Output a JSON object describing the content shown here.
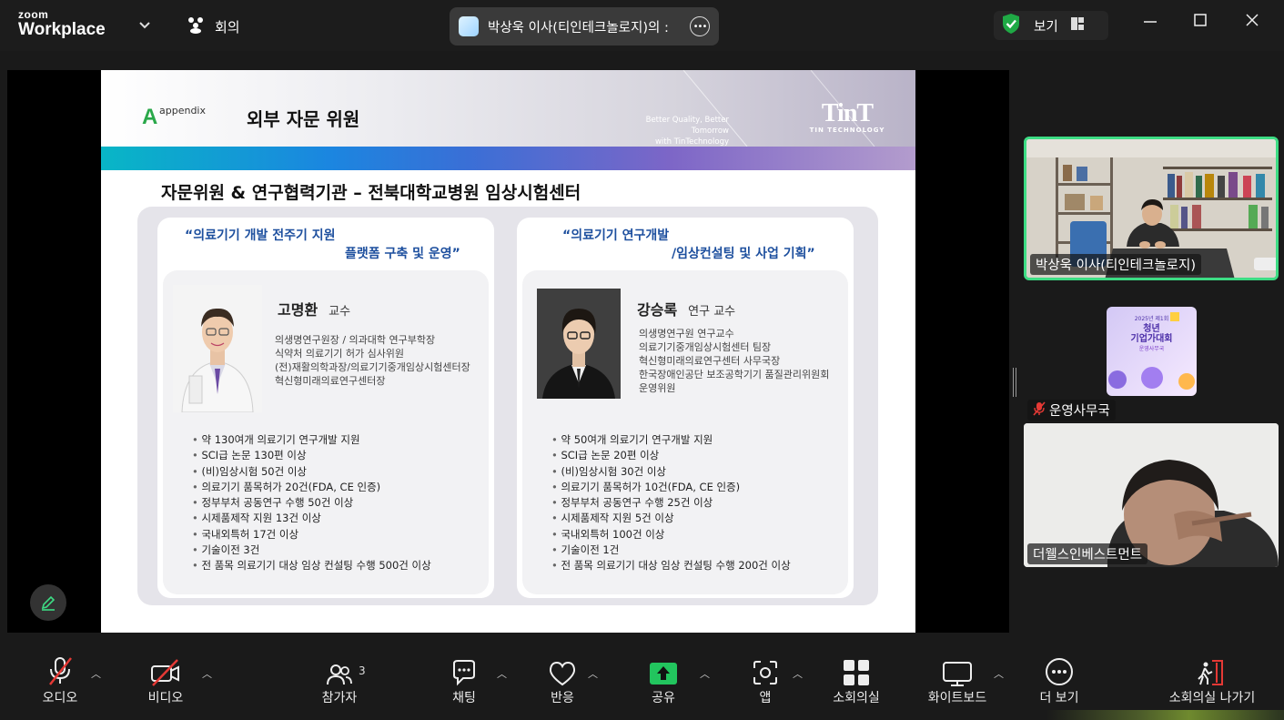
{
  "app": {
    "brand_line1": "zoom",
    "brand_line2": "Workplace",
    "meeting_label": "회의"
  },
  "share_pill": {
    "text": "박상욱 이사(티인테크놀로지)의 :"
  },
  "view_button": {
    "label": "보기"
  },
  "slide": {
    "appendix_letter": "A",
    "appendix_text": "appendix",
    "title": "외부 자문 위원",
    "tagline_1": "Better Quality, Better Tomorrow",
    "tagline_2": "with TinTechnology",
    "logo_big": "TinT",
    "logo_small": "TIN TECHNOLOGY",
    "subtitle": "자문위원 & 연구협력기관 – 전북대학교병원 임상시험센터",
    "left": {
      "quote_1": "“의료기기 개발 전주기 지원",
      "quote_2": "플랫폼 구축 및 운영”",
      "name": "고명환",
      "role": "교수",
      "cv": [
        "의생명연구원장 /  의과대학 연구부학장",
        "식약처 의료기기 허가 심사위원",
        "(전)재활의학과장/의료기기중개임상시험센터장",
        "혁신형미래의료연구센터장"
      ],
      "achievements": [
        "약 130여개 의료기기 연구개발 지원",
        "SCI급 논문 130편 이상",
        "(비)임상시험 50건 이상",
        "의료기기 품목허가 20건(FDA, CE 인증)",
        "정부부처 공동연구 수행 50건 이상",
        "시제품제작 지원 13건 이상",
        "국내외특허 17건 이상",
        "기술이전 3건",
        "전 품목 의료기기 대상 임상 컨설팅 수행 500건 이상"
      ]
    },
    "right": {
      "quote_1": "“의료기기 연구개발",
      "quote_2": "/임상컨설팅 및 사업 기획”",
      "name": "강승록",
      "role": "연구 교수",
      "cv": [
        "의생명연구원 연구교수",
        "의료기기중개임상시험센터 팀장",
        "혁신형미래의료연구센터 사무국장",
        "한국장애인공단 보조공학기기 품질관리위원회",
        "운영위원"
      ],
      "achievements": [
        "약 50여개 의료기기 연구개발 지원",
        "SCI급 논문 20편 이상",
        "(비)임상시험 30건 이상",
        "의료기기 품목허가 10건(FDA, CE 인증)",
        "정부부처 공동연구 수행 25건 이상",
        "시제품제작 지원 5건 이상",
        "국내외특허 100건 이상",
        "기술이전 1건",
        "전 품목 의료기기 대상 임상 컨설팅 수행 200건 이상"
      ]
    }
  },
  "participants": [
    {
      "name": "박상욱 이사(티인테크놀로지)",
      "active": true
    },
    {
      "name": "운영사무국",
      "muted": true,
      "poster_line1": "2025년 제1회",
      "poster_line2": "청년",
      "poster_line3": "기업가대회",
      "poster_line4": "운영사무국"
    },
    {
      "name": "더웰스인베스트먼트"
    }
  ],
  "toolbar": {
    "audio": "오디오",
    "video": "비디오",
    "participants": "참가자",
    "participants_count": "3",
    "chat": "채팅",
    "reactions": "반응",
    "share": "공유",
    "apps": "앱",
    "breakout": "소회의실",
    "whiteboard": "화이트보드",
    "more": "더 보기",
    "leave": "소회의실 나가기"
  },
  "colors": {
    "active_speaker_border": "#3ddc84",
    "share_green": "#22c55e",
    "quote_blue": "#1d4f9e"
  }
}
